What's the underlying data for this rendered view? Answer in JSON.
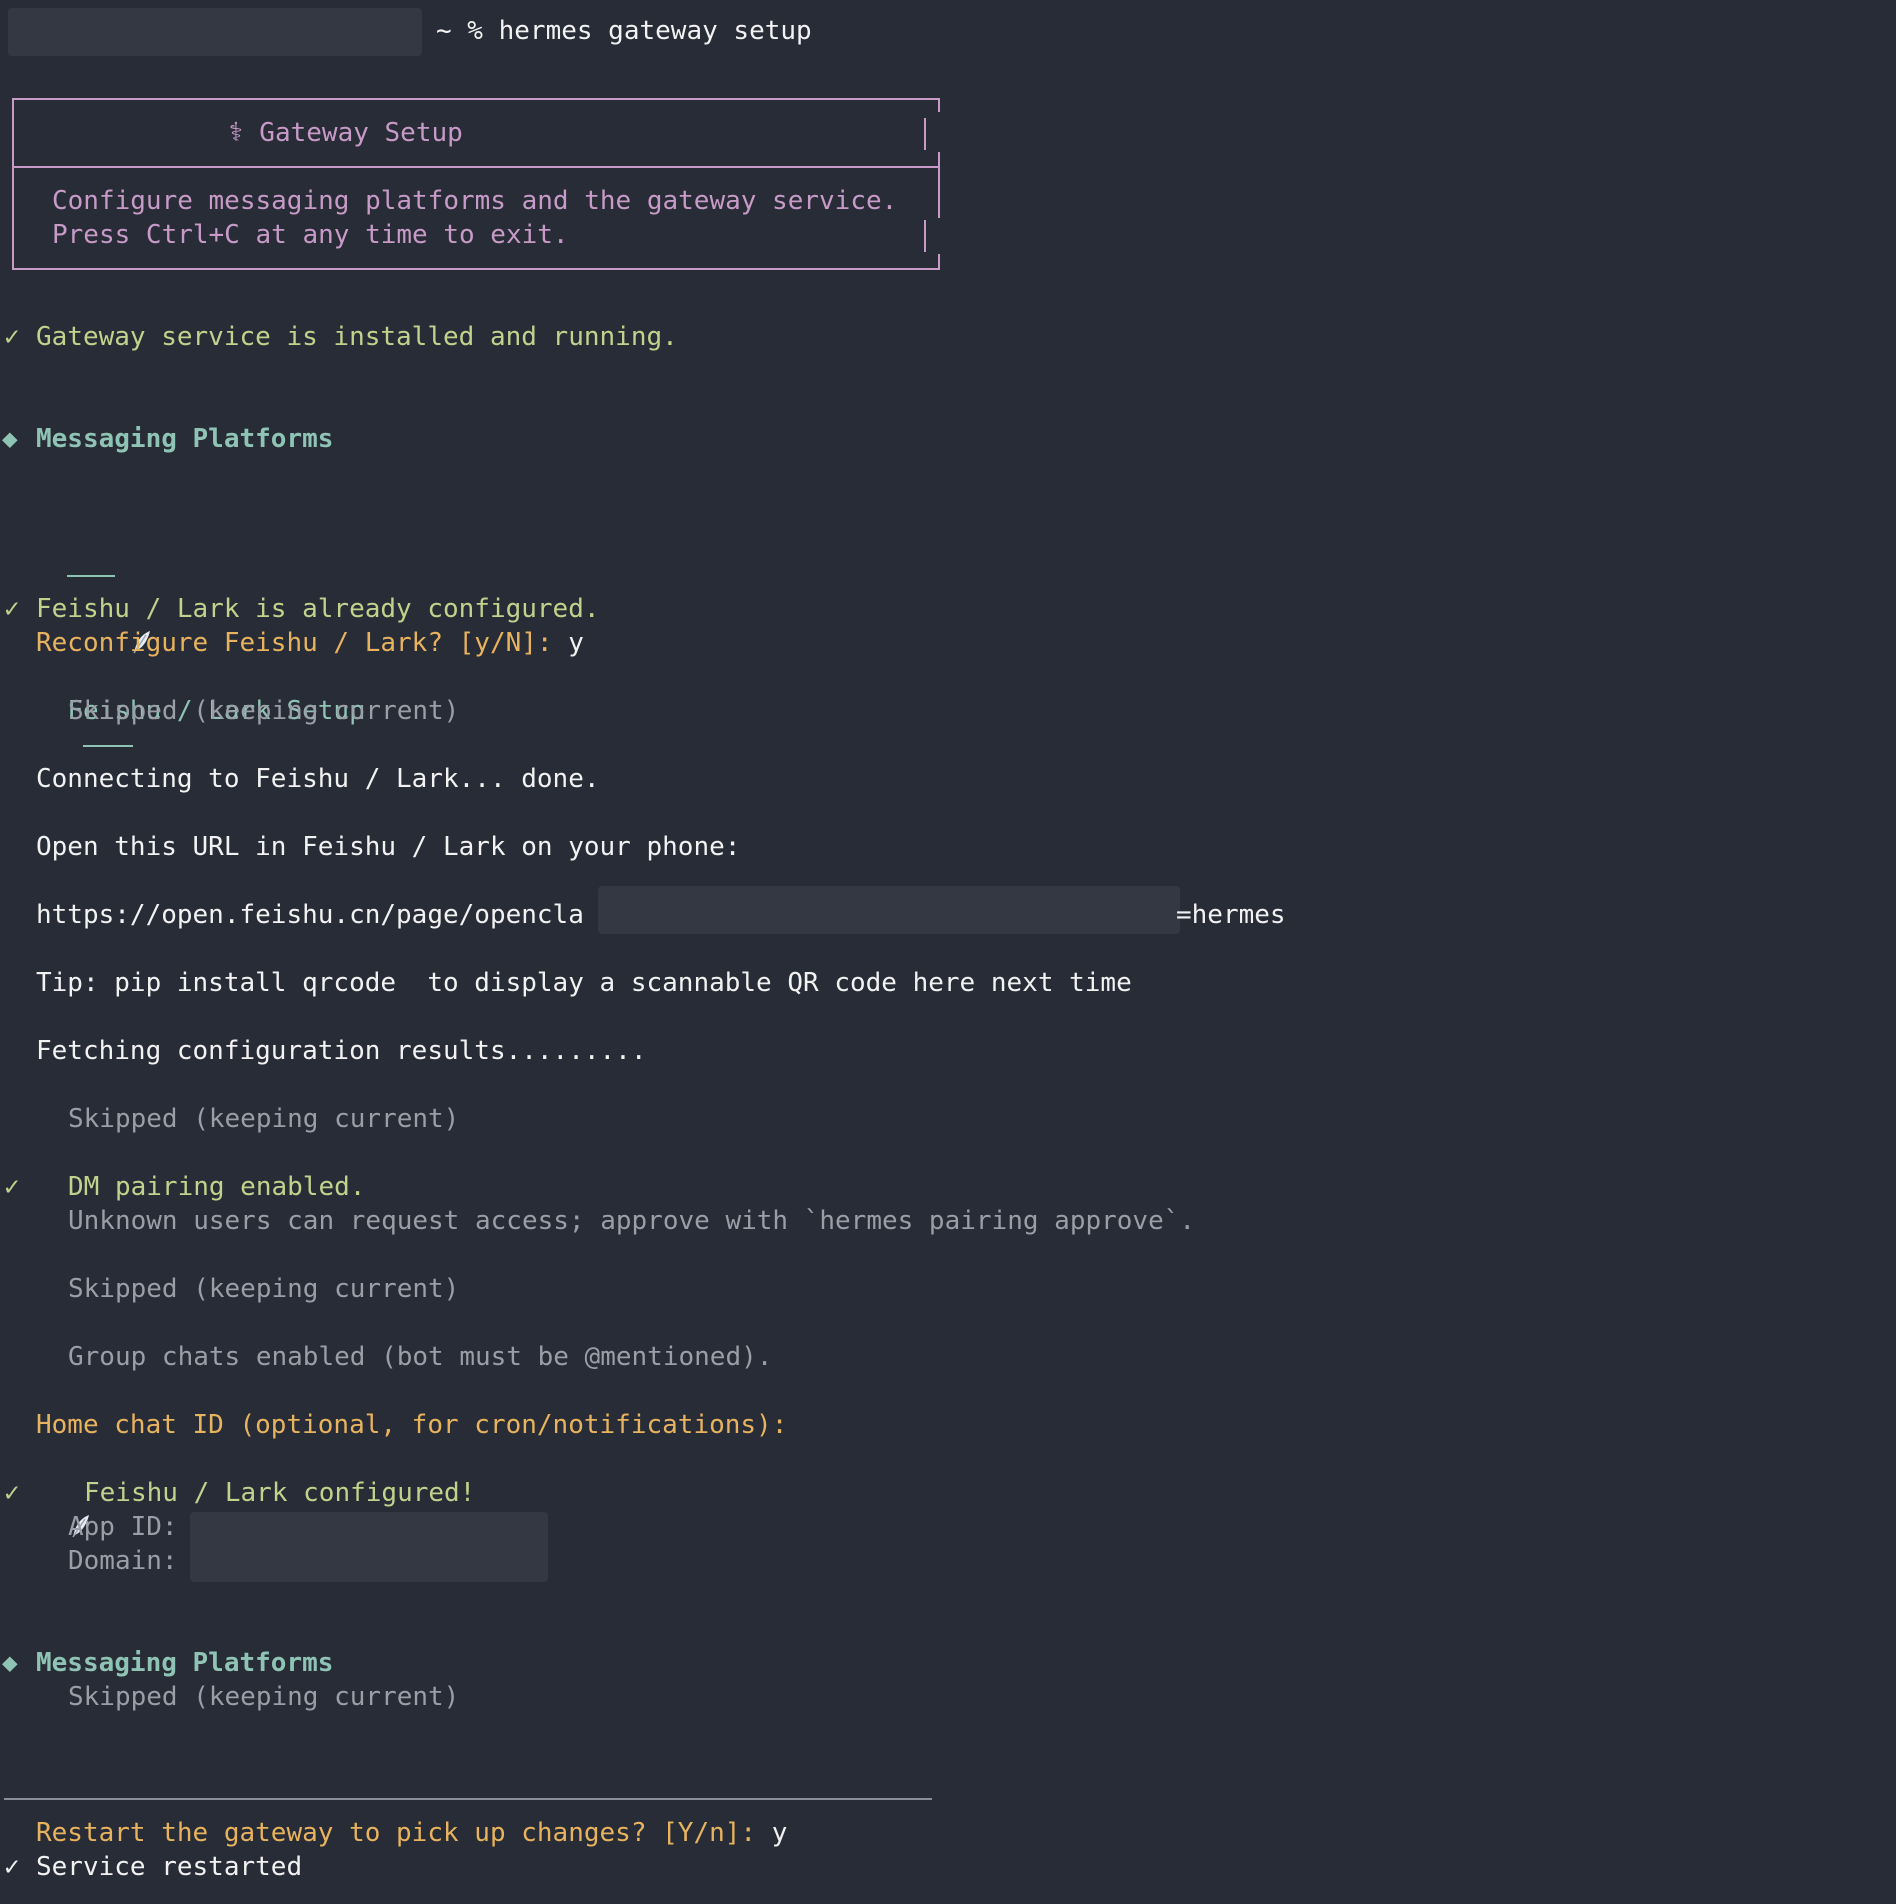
{
  "prompt": {
    "redacted_host": "",
    "command": "~ % hermes gateway setup"
  },
  "banner": {
    "title": "⚕ Gateway Setup",
    "line1": "Configure messaging platforms and the gateway service.",
    "line2": "Press Ctrl+C at any time to exit."
  },
  "status_running": {
    "icon": "✓",
    "text": "Gateway service is installed and running."
  },
  "section1": {
    "icon": "◆",
    "title": "Messaging Platforms"
  },
  "feishu_header": {
    "title": "Feishu / Lark Setup"
  },
  "already_configured": {
    "icon": "✓",
    "text": "Feishu / Lark is already configured."
  },
  "reconfigure": {
    "question": "Reconfigure Feishu / Lark? [y/N]: ",
    "answer": "y"
  },
  "skipped1": "Skipped (keeping current)",
  "connecting": "Connecting to Feishu / Lark... done.",
  "open_url_label": "Open this URL in Feishu / Lark on your phone:",
  "url": {
    "prefix": "https://open.feishu.cn/page/opencla",
    "suffix": "=hermes"
  },
  "tip": "Tip: pip install qrcode  to display a scannable QR code here next time",
  "fetching": "Fetching configuration results.........",
  "skipped2": "Skipped (keeping current)",
  "dm_pairing": {
    "icon": "✓",
    "text": "DM pairing enabled.",
    "detail": "Unknown users can request access; approve with `hermes pairing approve`."
  },
  "skipped3": "Skipped (keeping current)",
  "group_chats": "Group chats enabled (bot must be @mentioned).",
  "home_chat": "Home chat ID (optional, for cron/notifications):",
  "configured": {
    "icon": "✓",
    "text": "Feishu / Lark configured!",
    "app_id_label": "App ID:",
    "domain_label": "Domain:"
  },
  "section2": {
    "icon": "◆",
    "title": "Messaging Platforms",
    "skipped": "Skipped (keeping current)"
  },
  "restart": {
    "question": "Restart the gateway to pick up changes? [Y/n]: ",
    "answer": "y"
  },
  "service_restarted": {
    "icon": "✓",
    "text": "Service restarted"
  },
  "colors": {
    "background": "#282c36",
    "green": "#c2d28c",
    "gold": "#e8b35e",
    "teal": "#8fc4b5",
    "gray": "#9a9ea6",
    "purple": "#c79ac8"
  }
}
